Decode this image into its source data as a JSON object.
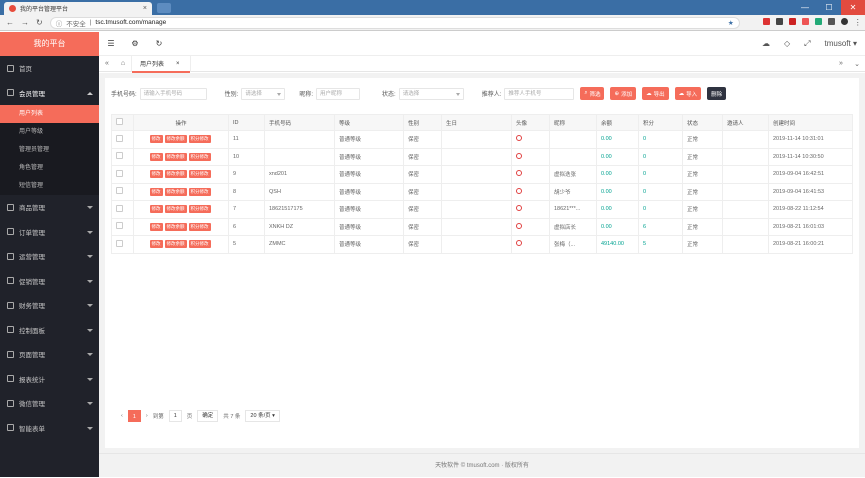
{
  "browser": {
    "tab_title": "我的平台管理平台",
    "tab_close": "×",
    "insecure_label": "不安全",
    "url": "tsc.tmusoft.com/manage",
    "window_controls": [
      "—",
      "☐",
      "✕"
    ]
  },
  "sidebar": {
    "logo": "我的平台",
    "home": "首页",
    "member_group": "会员管理",
    "sub_items": [
      "用户列表",
      "用户等级",
      "管理员管理",
      "角色管理",
      "短信管理"
    ],
    "groups": [
      "商品管理",
      "订单管理",
      "运营管理",
      "促销管理",
      "财务管理",
      "控制面板",
      "页面管理",
      "报表统计",
      "微信管理",
      "智能表单"
    ]
  },
  "topbar": {
    "menu_icon": "☰",
    "settings_icon": "⚙",
    "refresh_icon": "↻",
    "user": "tmusoft"
  },
  "tabs": {
    "prev": "«",
    "home_icon": "⌂",
    "active_tab": "用户列表",
    "close": "×",
    "next": "»",
    "more": "⌄"
  },
  "filters": {
    "phone_label": "手机号码:",
    "phone_placeholder": "请输入手机号码",
    "gender_label": "性别:",
    "gender_placeholder": "请选择",
    "nick_label": "昵称:",
    "nick_placeholder": "用户昵称",
    "status_label": "状态:",
    "status_placeholder": "请选择",
    "referrer_label": "推荐人:",
    "referrer_placeholder": "推荐人手机号",
    "search_btn": "筛选",
    "add_btn": "添加",
    "export_btn": "导出",
    "import_btn": "导入",
    "delete_btn": "删除"
  },
  "table": {
    "headers": [
      "操作",
      "ID",
      "手机号码",
      "等级",
      "性别",
      "生日",
      "头像",
      "昵称",
      "余额",
      "积分",
      "状态",
      "邀请人",
      "创建时间"
    ],
    "action_labels": [
      "修改",
      "修改余额",
      "积分修改"
    ],
    "rows": [
      {
        "id": "11",
        "phone": "",
        "level": "普通等级",
        "gender": "保密",
        "birthday": "",
        "nick": "",
        "balance": "0.00",
        "points": "0",
        "status": "正常",
        "inviter": "",
        "created": "2019-11-14 10:31:01"
      },
      {
        "id": "10",
        "phone": "",
        "level": "普通等级",
        "gender": "保密",
        "birthday": "",
        "nick": "",
        "balance": "0.00",
        "points": "0",
        "status": "正常",
        "inviter": "",
        "created": "2019-11-14 10:30:50"
      },
      {
        "id": "9",
        "phone": "xnd201",
        "level": "普通等级",
        "gender": "保密",
        "birthday": "",
        "nick": "虚拟迭张",
        "balance": "0.00",
        "points": "0",
        "status": "正常",
        "inviter": "",
        "created": "2019-09-04 16:42:51"
      },
      {
        "id": "8",
        "phone": "QSH",
        "level": "普通等级",
        "gender": "保密",
        "birthday": "",
        "nick": "胡少爷",
        "balance": "0.00",
        "points": "0",
        "status": "正常",
        "inviter": "",
        "created": "2019-09-04 16:41:53"
      },
      {
        "id": "7",
        "phone": "18621517175",
        "level": "普通等级",
        "gender": "保密",
        "birthday": "",
        "nick": "18621***...",
        "balance": "0.00",
        "points": "0",
        "status": "正常",
        "inviter": "",
        "created": "2019-08-22 11:12:54"
      },
      {
        "id": "6",
        "phone": "XNKH DZ",
        "level": "普通等级",
        "gender": "保密",
        "birthday": "",
        "nick": "虚拟店长",
        "balance": "0.00",
        "points": "6",
        "status": "正常",
        "inviter": "",
        "created": "2019-08-21 16:01:03"
      },
      {
        "id": "5",
        "phone": "ZMMC",
        "level": "普通等级",
        "gender": "保密",
        "birthday": "",
        "nick": "张梅（...",
        "balance": "49140.00",
        "points": "5",
        "status": "正常",
        "inviter": "",
        "created": "2019-08-21 16:00:21"
      }
    ]
  },
  "pager": {
    "prev": "‹",
    "current": "1",
    "next": "›",
    "goto_label": "到第",
    "goto_value": "1",
    "page_unit": "页",
    "confirm": "确定",
    "total": "共 7 条",
    "per_page": "20 条/页"
  },
  "footer": "天牧软件 © tmusoft.com · 版权所有"
}
